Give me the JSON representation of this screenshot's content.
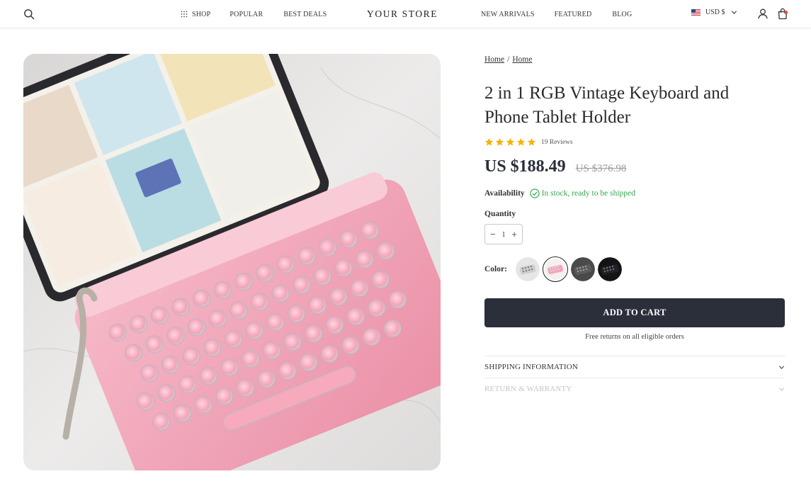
{
  "header": {
    "nav_left": [
      {
        "label": "SHOP"
      },
      {
        "label": "POPULAR"
      },
      {
        "label": "BEST DEALS"
      }
    ],
    "logo": "YOUR STORE",
    "nav_right": [
      {
        "label": "NEW ARRIVALS"
      },
      {
        "label": "FEATURED"
      },
      {
        "label": "BLOG"
      }
    ],
    "currency": "USD $",
    "icons": [
      "search-icon",
      "grid-icon",
      "us-flag-icon",
      "chevron-down-icon",
      "account-icon",
      "cart-icon"
    ]
  },
  "breadcrumb": [
    "Home",
    "Home"
  ],
  "breadcrumb_separator": "/",
  "product": {
    "title": "2 in 1 RGB Vintage Keyboard and Phone Tablet Holder",
    "rating": 5,
    "review_count": "19 Reviews",
    "price": "US $188.49",
    "compare_price": "US $376.98",
    "availability_label": "Availability",
    "availability_text": "In stock, ready to be shipped",
    "quantity_label": "Quantity",
    "quantity": "1",
    "color_label": "Color:",
    "colors": [
      "White",
      "Pink",
      "Grey",
      "Black"
    ],
    "selected_color": "Pink",
    "add_to_cart": "ADD TO CART",
    "free_returns": "Free returns on all eligible orders"
  },
  "accordions": [
    {
      "title": "SHIPPING INFORMATION"
    },
    {
      "title": "RETURN & WARRANTY"
    }
  ],
  "colors": {
    "accent": "#2b2f3a",
    "star": "#f5b400",
    "in_stock": "#39a650",
    "muted": "#c4c4c4"
  }
}
